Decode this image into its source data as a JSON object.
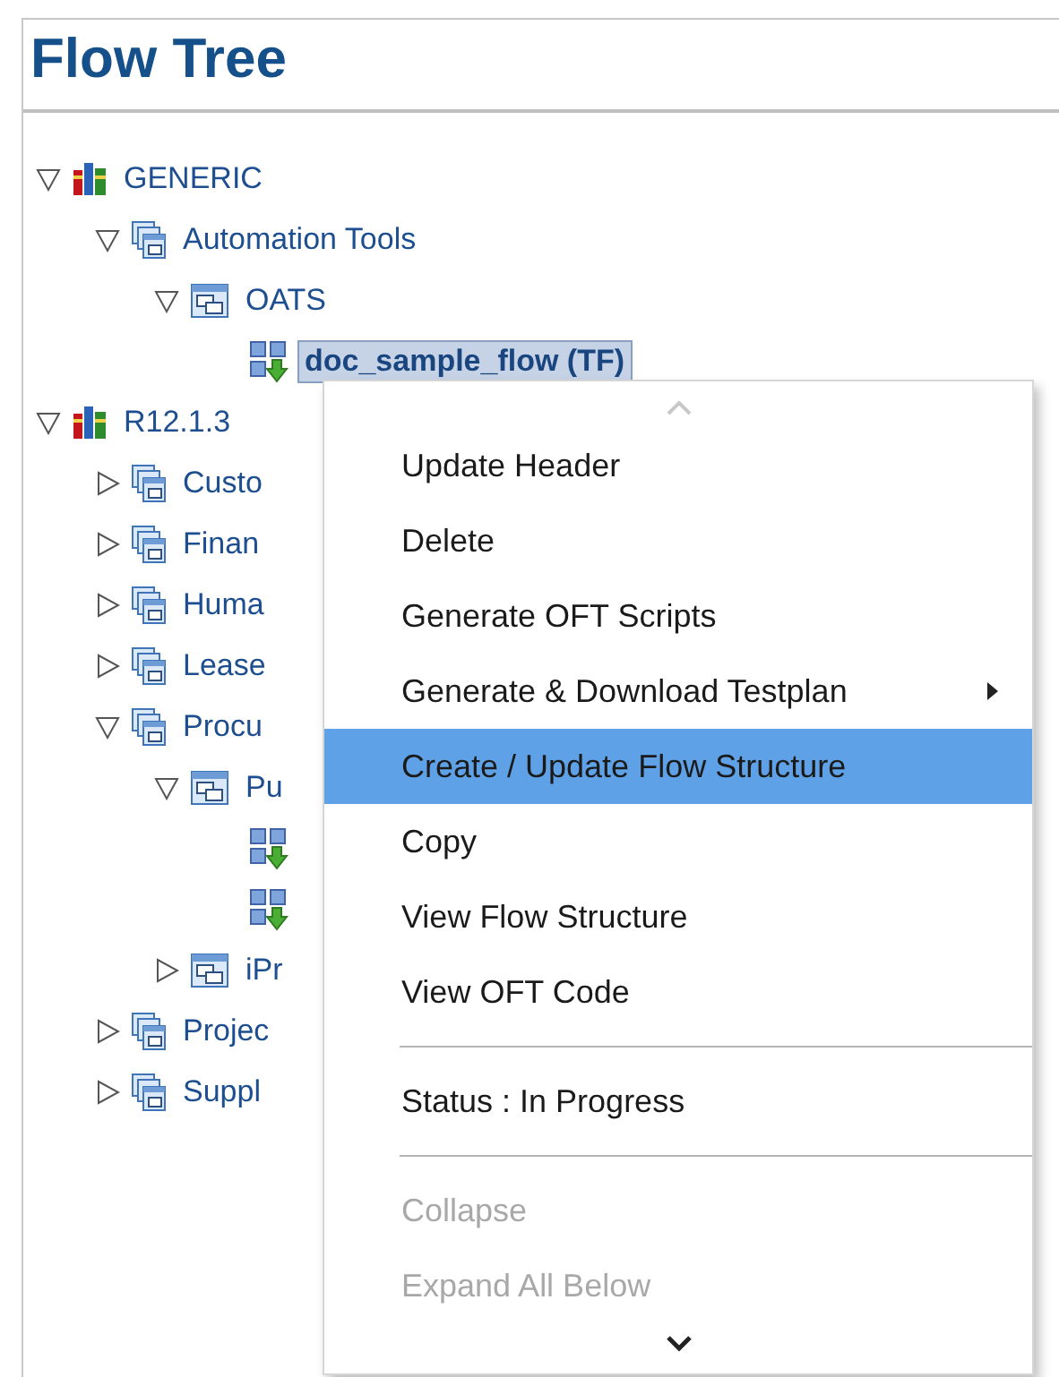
{
  "panel": {
    "title": "Flow Tree"
  },
  "tree": [
    {
      "label": "GENERIC",
      "kind": "library",
      "expanded": true,
      "children": [
        {
          "label": "Automation Tools",
          "kind": "module",
          "expanded": true,
          "children": [
            {
              "label": "OATS",
              "kind": "folder",
              "expanded": true,
              "children": [
                {
                  "label": "doc_sample_flow (TF)",
                  "kind": "flow",
                  "selected": true
                }
              ]
            }
          ]
        }
      ]
    },
    {
      "label": "R12.1.3",
      "kind": "library",
      "expanded": true,
      "children": [
        {
          "label": "Custo",
          "kind": "module",
          "expanded": false
        },
        {
          "label": "Finan",
          "kind": "module",
          "expanded": false
        },
        {
          "label": "Huma",
          "kind": "module",
          "expanded": false
        },
        {
          "label": "Lease",
          "kind": "module",
          "expanded": false
        },
        {
          "label": "Procu",
          "kind": "module",
          "expanded": true,
          "children": [
            {
              "label": "Pu",
              "kind": "folder",
              "expanded": true,
              "children": [
                {
                  "kind": "flow",
                  "selected": false
                },
                {
                  "kind": "flow",
                  "selected": false
                }
              ]
            },
            {
              "label": "iPr",
              "kind": "folder",
              "expanded": false
            }
          ]
        },
        {
          "label": "Projec",
          "kind": "module",
          "expanded": false
        },
        {
          "label": "Suppl",
          "kind": "module",
          "expanded": false
        }
      ]
    }
  ],
  "context_menu": {
    "items": [
      {
        "kind": "item",
        "label": "Update Header",
        "selected": false,
        "disabled": false
      },
      {
        "kind": "item",
        "label": "Delete",
        "selected": false,
        "disabled": false
      },
      {
        "kind": "item",
        "label": "Generate OFT Scripts",
        "selected": false,
        "disabled": false
      },
      {
        "kind": "item",
        "label": "Generate & Download Testplan",
        "selected": false,
        "disabled": false,
        "submenu": true
      },
      {
        "kind": "item",
        "label": "Create / Update Flow Structure",
        "selected": true,
        "disabled": false
      },
      {
        "kind": "item",
        "label": "Copy",
        "selected": false,
        "disabled": false
      },
      {
        "kind": "item",
        "label": "View Flow Structure",
        "selected": false,
        "disabled": false
      },
      {
        "kind": "item",
        "label": "View OFT Code",
        "selected": false,
        "disabled": false
      },
      {
        "kind": "separator"
      },
      {
        "kind": "item",
        "label": "Status : In Progress",
        "selected": false,
        "disabled": false
      },
      {
        "kind": "separator"
      },
      {
        "kind": "item",
        "label": "Collapse",
        "selected": false,
        "disabled": true
      },
      {
        "kind": "item",
        "label": "Expand All Below",
        "selected": false,
        "disabled": true
      }
    ]
  }
}
